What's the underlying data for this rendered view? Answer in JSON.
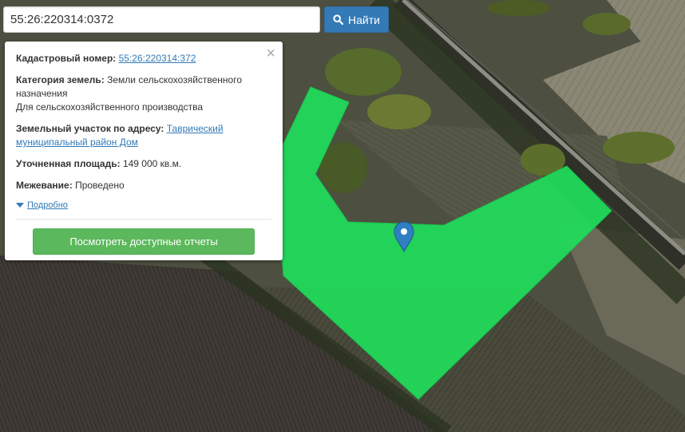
{
  "search": {
    "value": "55:26:220314:0372",
    "button_label": "Найти"
  },
  "popup": {
    "close_glyph": "×",
    "cadastral_label": "Кадастровый номер:",
    "cadastral_value": "55:26:220314:372",
    "category_label": "Категория земель:",
    "category_value": "Земли сельскохозяйственного назначения",
    "category_extra": "Для сельскохозяйственного производства",
    "address_label": "Земельный участок по адресу:",
    "address_value": "Таврический муниципальный район Дом",
    "area_label": "Уточненная площадь:",
    "area_value": "149 000 кв.м.",
    "survey_label": "Межевание:",
    "survey_value": "Проведено",
    "details_link": "Подробно",
    "report_button": "Посмотреть доступные отчеты"
  },
  "colors": {
    "parcel_fill": "#1fdd5a",
    "marker": "#2f7fc1",
    "primary_button": "#337ab7",
    "success_button": "#5cb85c"
  },
  "icons": {
    "search": "search-icon",
    "marker": "map-marker-icon",
    "close": "close-icon",
    "details": "caret-down-icon"
  }
}
